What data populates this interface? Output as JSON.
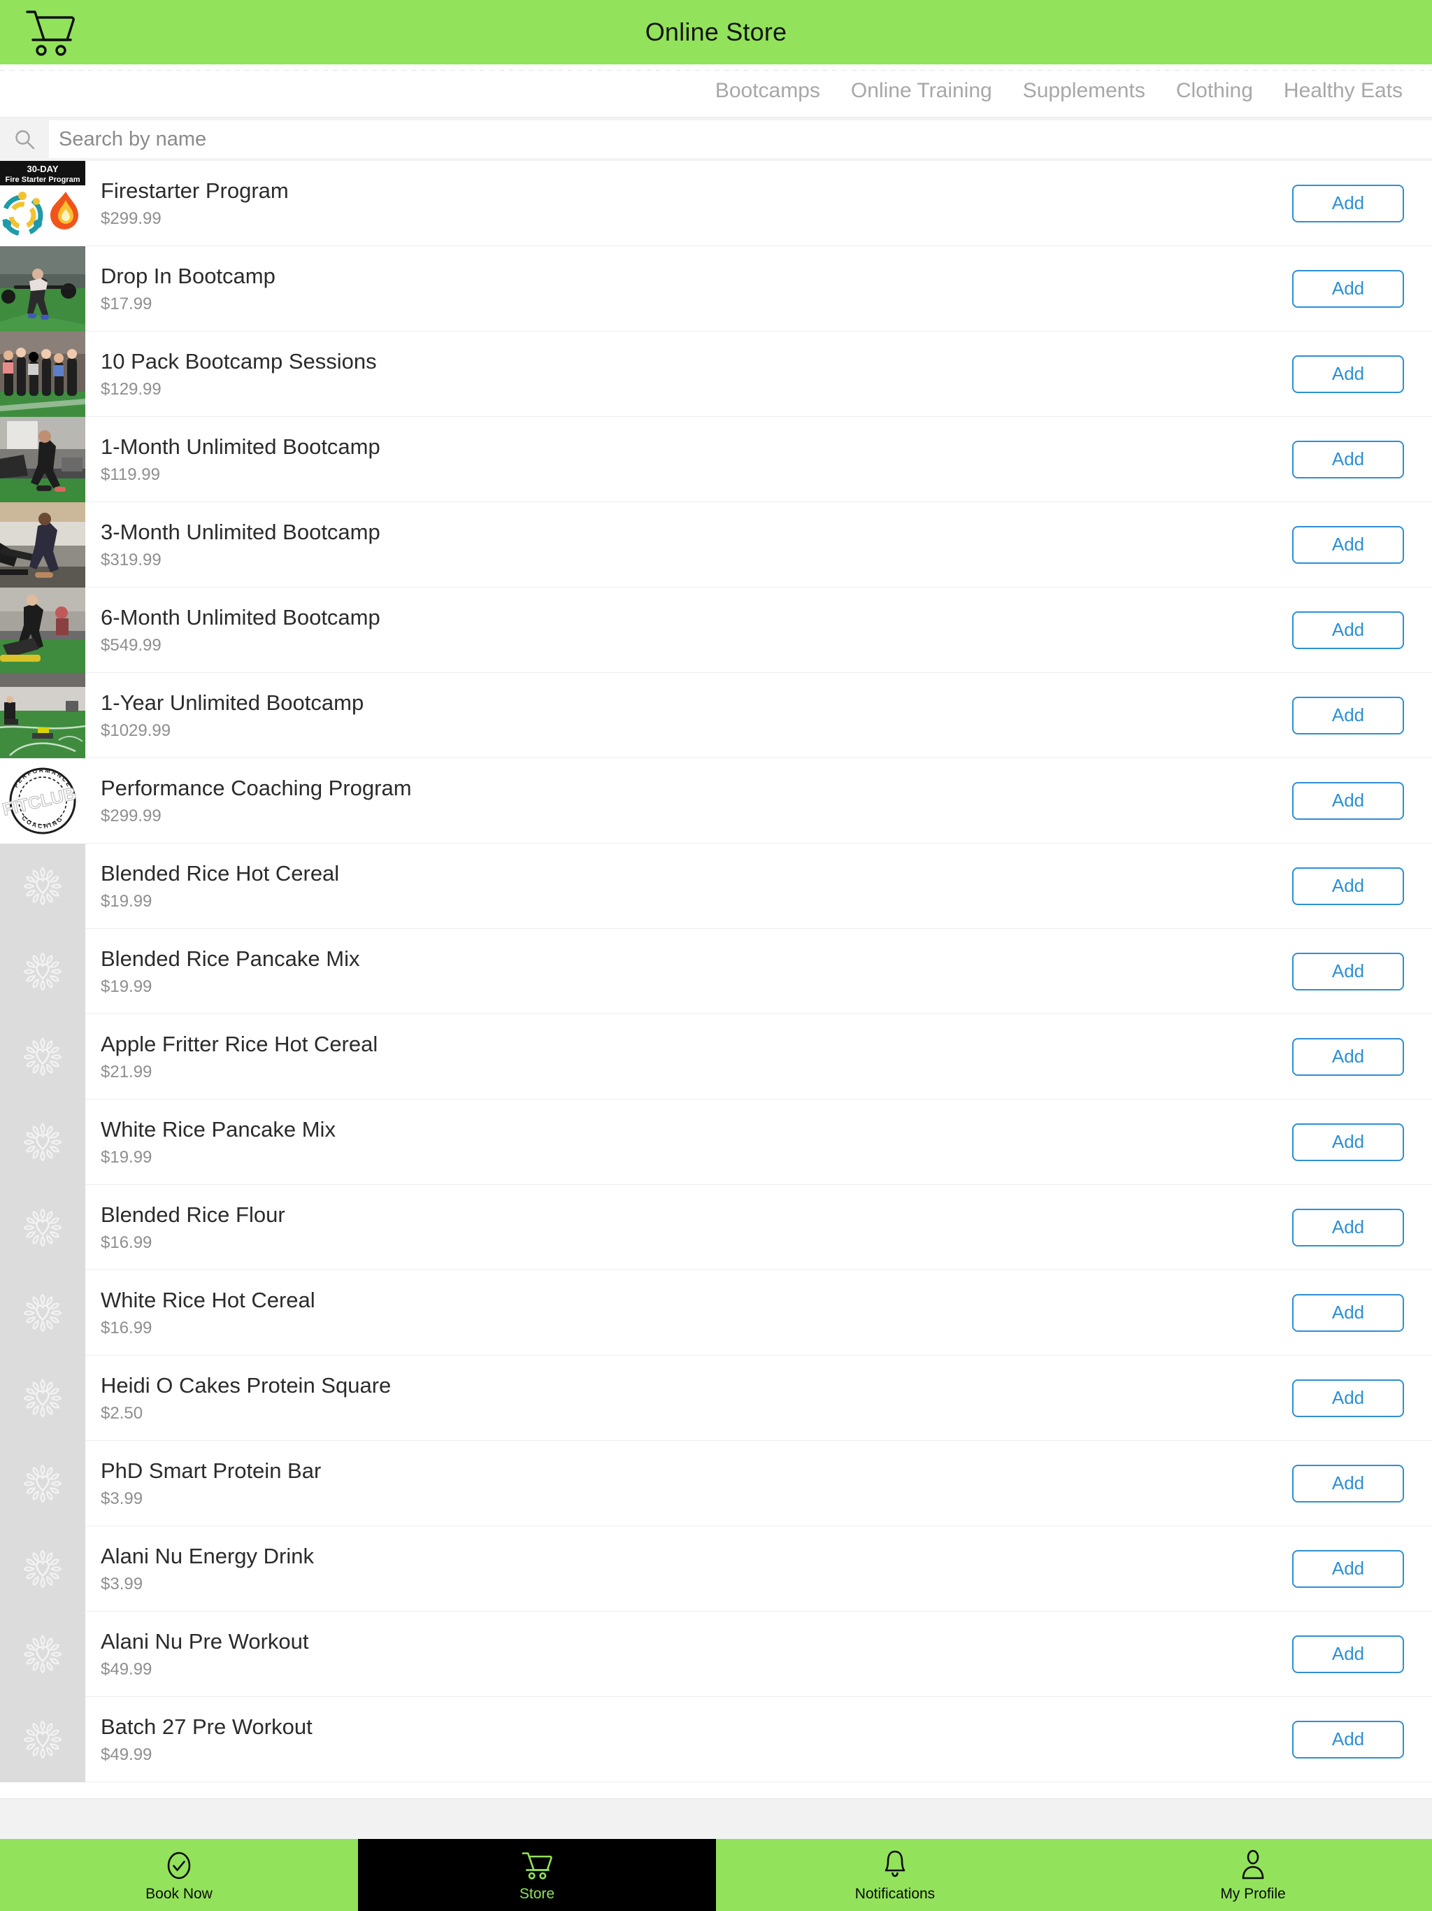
{
  "header": {
    "title": "Online Store",
    "cart_icon": "shopping-cart-icon",
    "accent_green": "#92e35b",
    "accent_blue": "#2e8fd4"
  },
  "categories": [
    {
      "label": "Bootcamps"
    },
    {
      "label": "Online Training"
    },
    {
      "label": "Supplements"
    },
    {
      "label": "Clothing"
    },
    {
      "label": "Healthy Eats"
    }
  ],
  "search": {
    "icon": "search-icon",
    "placeholder": "Search by name",
    "value": ""
  },
  "list": {
    "add_label": "Add",
    "products": [
      {
        "name": "Firestarter Program",
        "price": "$299.99",
        "thumb": "firestarter"
      },
      {
        "name": "Drop In Bootcamp",
        "price": "$17.99",
        "thumb": "dropin"
      },
      {
        "name": "10 Pack Bootcamp Sessions",
        "price": "$129.99",
        "thumb": "tenpack"
      },
      {
        "name": "1-Month Unlimited Bootcamp",
        "price": "$119.99",
        "thumb": "month1"
      },
      {
        "name": "3-Month Unlimited Bootcamp",
        "price": "$319.99",
        "thumb": "month3"
      },
      {
        "name": "6-Month Unlimited Bootcamp",
        "price": "$549.99",
        "thumb": "month6"
      },
      {
        "name": "1-Year Unlimited Bootcamp",
        "price": "$1029.99",
        "thumb": "year1"
      },
      {
        "name": "Performance Coaching Program",
        "price": "$299.99",
        "thumb": "fitclub"
      },
      {
        "name": "Blended Rice Hot Cereal",
        "price": "$19.99",
        "thumb": "placeholder"
      },
      {
        "name": "Blended Rice Pancake Mix",
        "price": "$19.99",
        "thumb": "placeholder"
      },
      {
        "name": "Apple Fritter Rice Hot Cereal",
        "price": "$21.99",
        "thumb": "placeholder"
      },
      {
        "name": "White Rice Pancake Mix",
        "price": "$19.99",
        "thumb": "placeholder"
      },
      {
        "name": "Blended Rice Flour",
        "price": "$16.99",
        "thumb": "placeholder"
      },
      {
        "name": "White Rice Hot Cereal",
        "price": "$16.99",
        "thumb": "placeholder"
      },
      {
        "name": "Heidi O Cakes Protein Square",
        "price": "$2.50",
        "thumb": "placeholder"
      },
      {
        "name": "PhD Smart Protein Bar",
        "price": "$3.99",
        "thumb": "placeholder"
      },
      {
        "name": "Alani Nu Energy Drink",
        "price": "$3.99",
        "thumb": "placeholder"
      },
      {
        "name": "Alani Nu Pre Workout",
        "price": "$49.99",
        "thumb": "placeholder"
      },
      {
        "name": "Batch 27 Pre Workout",
        "price": "$49.99",
        "thumb": "placeholder"
      }
    ]
  },
  "thumb_text": {
    "firestarter_line1": "30-DAY",
    "firestarter_line2": "Fire Starter Program",
    "fitclub_top": "PERFORMANCE",
    "fitclub_center": "FITCLUB",
    "fitclub_bottom": "COACHING"
  },
  "bottom_nav": {
    "items": [
      {
        "label": "Book Now",
        "icon": "check-circle-icon",
        "active": false
      },
      {
        "label": "Store",
        "icon": "shopping-cart-icon",
        "active": true
      },
      {
        "label": "Notifications",
        "icon": "bell-icon",
        "active": false
      },
      {
        "label": "My Profile",
        "icon": "person-icon",
        "active": false
      }
    ]
  }
}
